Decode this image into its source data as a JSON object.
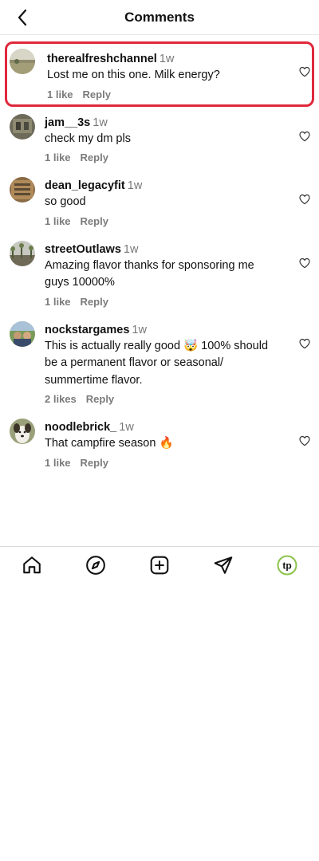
{
  "header": {
    "title": "Comments",
    "back_icon": "chevron-left-icon"
  },
  "comments": [
    {
      "username": "therealfreshchannel",
      "time": "1w",
      "text": "Lost me on this one. Milk energy?",
      "likes": "1 like",
      "reply": "Reply"
    },
    {
      "username": "jam__3s",
      "time": "1w",
      "text": "check my dm pls",
      "likes": "1 like",
      "reply": "Reply"
    },
    {
      "username": "dean_legacyfit",
      "time": "1w",
      "text": "so good",
      "likes": "1 like",
      "reply": "Reply"
    },
    {
      "username": "streetOutlaws",
      "time": "1w",
      "text": "Amazing flavor thanks for sponsoring me guys 10000%",
      "likes": "1 like",
      "reply": "Reply"
    },
    {
      "username": "nockstargames",
      "time": "1w",
      "text": "This is actually really good 🤯 100% should be a permanent flavor or seasonal/ summertime flavor.",
      "likes": "2 likes",
      "reply": "Reply"
    },
    {
      "username": "noodlebrick_",
      "time": "1w",
      "text": "That campfire season 🔥",
      "likes": "1 like",
      "reply": "Reply"
    }
  ],
  "nav": {
    "items": [
      "home-icon",
      "explore-icon",
      "new-post-icon",
      "direct-message-icon",
      "profile-avatar"
    ],
    "profile_initials": "tp"
  },
  "colors": {
    "highlight": "#e0283c",
    "meta": "#7b7b7b",
    "profile_accent": "#8bc34a"
  }
}
